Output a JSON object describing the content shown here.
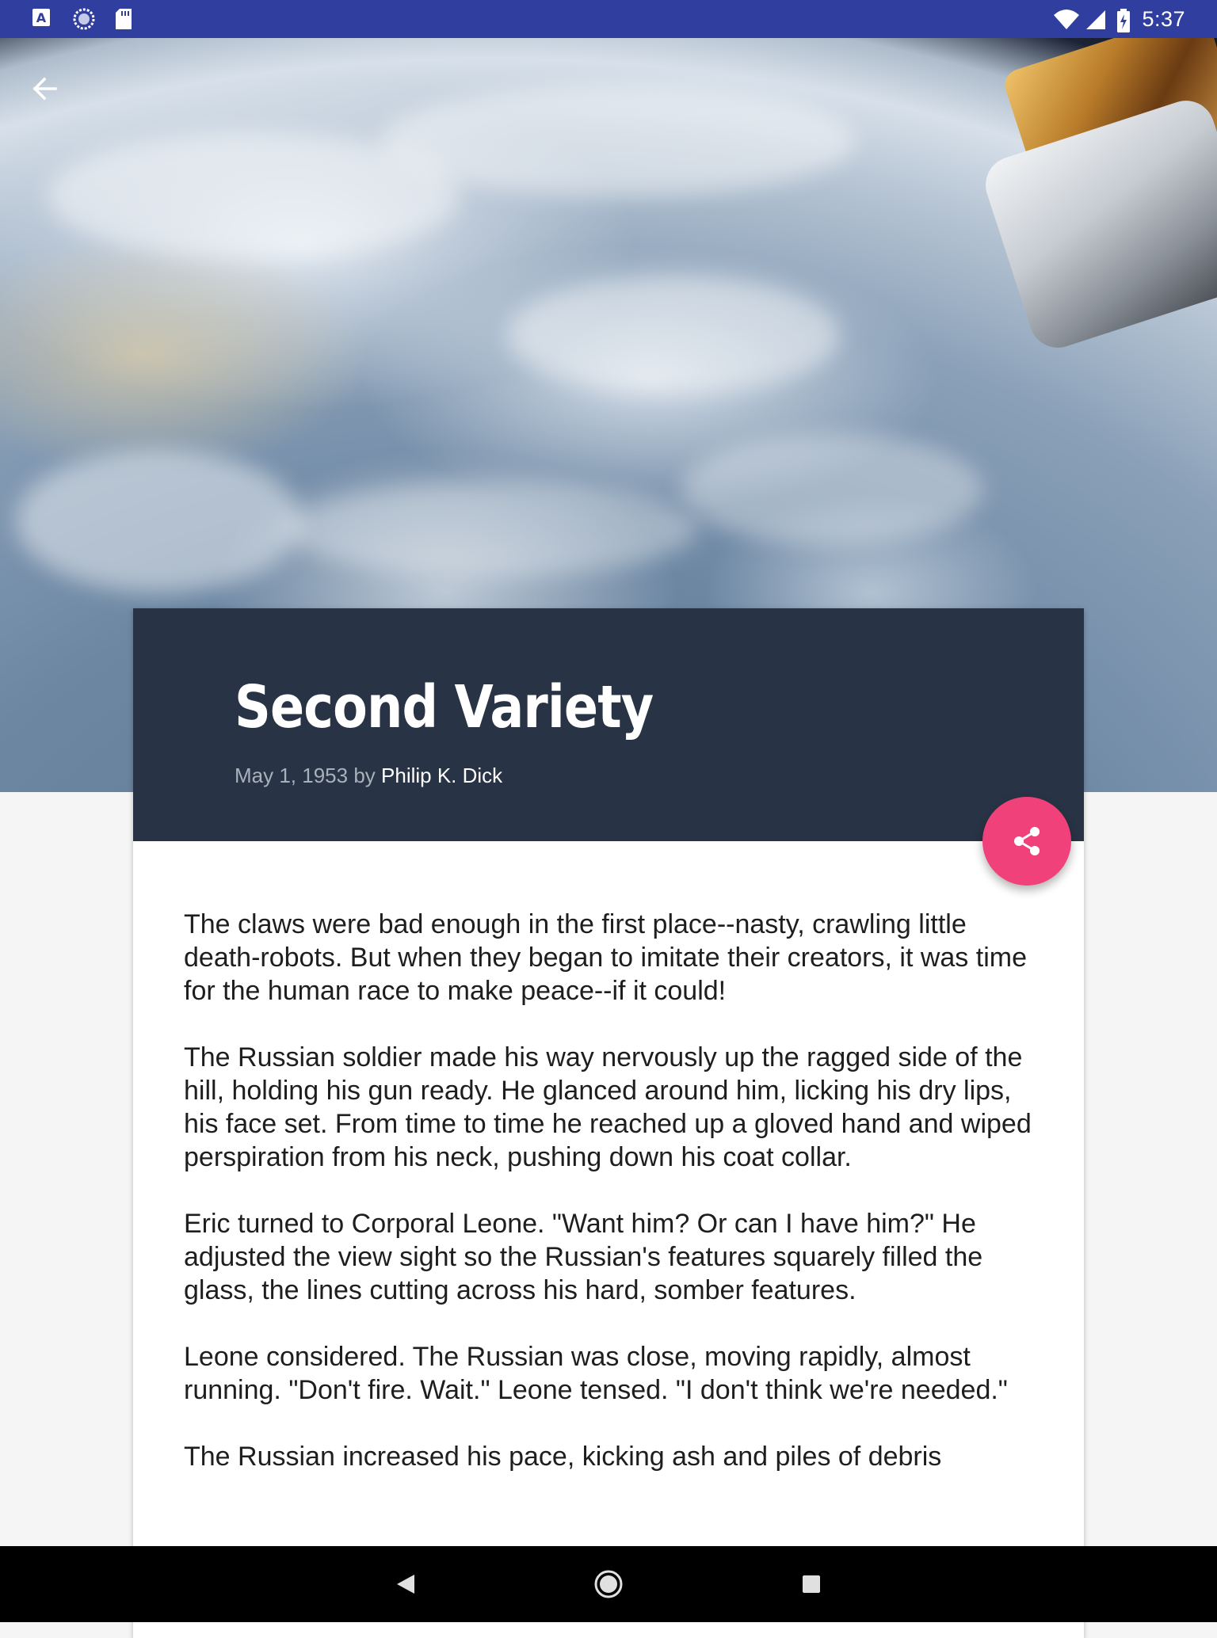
{
  "status_bar": {
    "time": "5:37",
    "left_icons": [
      "a-icon",
      "sync-icon",
      "sd-card-icon"
    ],
    "right_icons": [
      "wifi-icon",
      "signal-icon",
      "battery-charging-icon"
    ]
  },
  "toolbar": {
    "back_icon": "arrow-back-icon"
  },
  "story": {
    "title": "Second Variety",
    "date_by": "May 1, 1953 by",
    "author": "Philip K. Dick",
    "paragraphs": [
      "The claws were bad enough in the first place--nasty, crawling little death-robots. But when they began to imitate their creators, it was time for the human race to make peace--if it could!",
      "The Russian soldier made his way nervously up the ragged side of the hill, holding his gun ready. He glanced around him, licking his dry lips, his face set. From time to time he reached up a gloved hand and wiped perspiration from his neck, pushing down his coat collar.",
      "Eric turned to Corporal Leone. \"Want him? Or can I have him?\" He adjusted the view sight so the Russian's features squarely filled the glass, the lines cutting across his hard, somber features.",
      "Leone considered. The Russian was close, moving rapidly, almost running. \"Don't fire. Wait.\" Leone tensed. \"I don't think we're needed.\"",
      "The Russian increased his pace, kicking ash and piles of debris"
    ]
  },
  "fab": {
    "icon": "share-icon",
    "color": "#f0417b"
  },
  "nav_bar": {
    "icons": [
      "back-triangle-icon",
      "home-circle-icon",
      "recents-square-icon"
    ]
  },
  "colors": {
    "status_bar": "#303f9f",
    "card_header": "#283445",
    "accent": "#f0417b"
  }
}
